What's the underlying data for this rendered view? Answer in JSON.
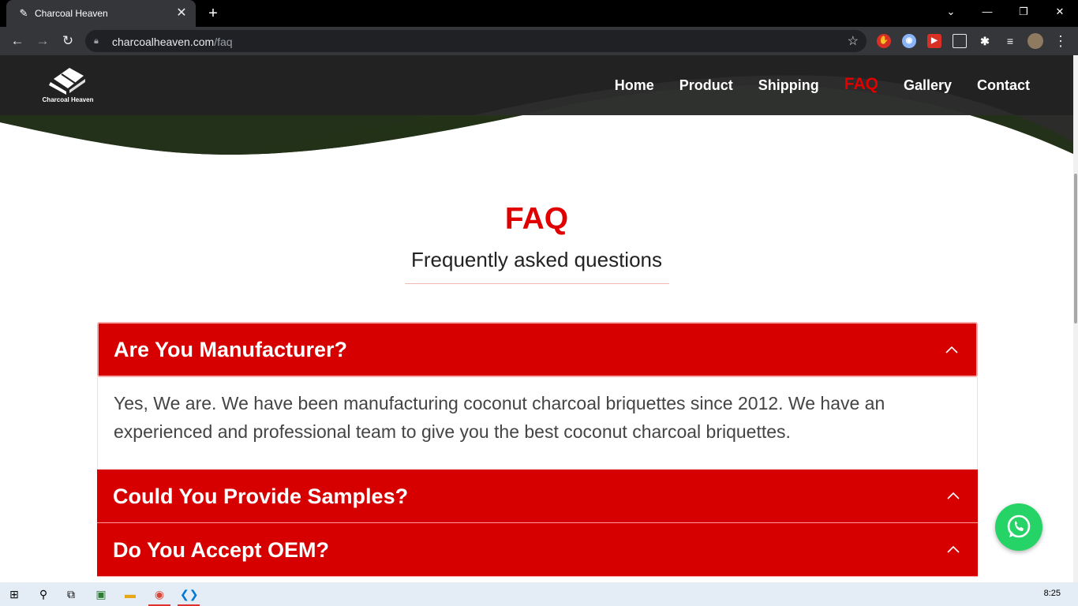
{
  "browser": {
    "tab_title": "Charcoal Heaven",
    "url_host": "charcoalheaven.com",
    "url_path": "/faq"
  },
  "site": {
    "logo_text": "Charcoal Heaven",
    "nav": {
      "home": "Home",
      "product": "Product",
      "shipping": "Shipping",
      "faq": "FAQ",
      "gallery": "Gallery",
      "contact": "Contact"
    },
    "active_nav": "faq"
  },
  "page": {
    "title": "FAQ",
    "subtitle": "Frequently asked questions"
  },
  "faq": {
    "q1": "Are You Manufacturer?",
    "a1": "Yes, We are. We have been manufacturing coconut charcoal briquettes since 2012. We have an experienced and professional team to give you the best coconut charcoal briquettes.",
    "q2": "Could You Provide Samples?",
    "q3": "Do You Accept OEM?"
  },
  "taskbar": {
    "clock": "8:25"
  },
  "colors": {
    "accent_red": "#d70000",
    "whatsapp_green": "#25d366"
  }
}
